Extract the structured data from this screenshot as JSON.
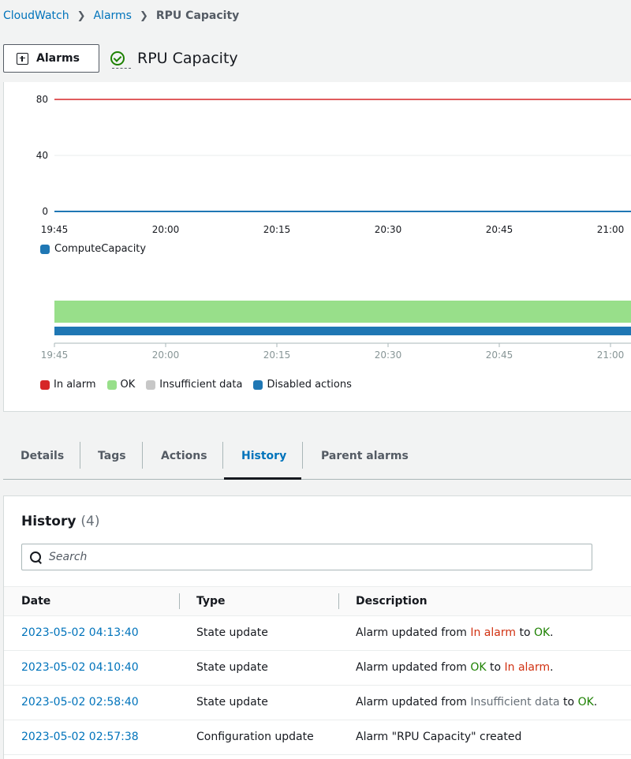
{
  "breadcrumb": {
    "items": [
      "CloudWatch",
      "Alarms"
    ],
    "current": "RPU Capacity"
  },
  "header": {
    "alarms_button": "Alarms",
    "title": "RPU Capacity",
    "status": "ok"
  },
  "metric_chart": {
    "y_ticks": [
      "80",
      "40",
      "0"
    ],
    "x_ticks": [
      "19:45",
      "20:00",
      "20:15",
      "20:30",
      "20:45",
      "21:00"
    ],
    "threshold": 80,
    "legend": [
      "ComputeCapacity"
    ],
    "series_color": "#1f77b4",
    "threshold_color": "#d62728"
  },
  "status_chart": {
    "x_ticks": [
      "19:45",
      "20:00",
      "20:15",
      "20:30",
      "20:45",
      "21:00"
    ],
    "legend": [
      {
        "label": "In alarm",
        "color": "#d62728"
      },
      {
        "label": "OK",
        "color": "#98df8a"
      },
      {
        "label": "Insufficient data",
        "color": "#c7c7c7"
      },
      {
        "label": "Disabled actions",
        "color": "#1f77b4"
      }
    ]
  },
  "tabs": [
    {
      "label": "Details",
      "active": false
    },
    {
      "label": "Tags",
      "active": false
    },
    {
      "label": "Actions",
      "active": false
    },
    {
      "label": "History",
      "active": true
    },
    {
      "label": "Parent alarms",
      "active": false
    }
  ],
  "history": {
    "title": "History",
    "count": "(4)",
    "search_placeholder": "Search",
    "columns": [
      "Date",
      "Type",
      "Description"
    ],
    "rows": [
      {
        "date": "2023-05-02 04:13:40",
        "type": "State update",
        "desc": [
          {
            "t": "Alarm updated from ",
            "c": ""
          },
          {
            "t": "In alarm",
            "c": "red"
          },
          {
            "t": " to ",
            "c": ""
          },
          {
            "t": "OK",
            "c": "green"
          },
          {
            "t": ".",
            "c": ""
          }
        ]
      },
      {
        "date": "2023-05-02 04:10:40",
        "type": "State update",
        "desc": [
          {
            "t": "Alarm updated from ",
            "c": ""
          },
          {
            "t": "OK",
            "c": "green"
          },
          {
            "t": " to ",
            "c": ""
          },
          {
            "t": "In alarm",
            "c": "red"
          },
          {
            "t": ".",
            "c": ""
          }
        ]
      },
      {
        "date": "2023-05-02 02:58:40",
        "type": "State update",
        "desc": [
          {
            "t": "Alarm updated from ",
            "c": ""
          },
          {
            "t": "Insufficient data",
            "c": "gray"
          },
          {
            "t": " to ",
            "c": ""
          },
          {
            "t": "OK",
            "c": "green"
          },
          {
            "t": ".",
            "c": ""
          }
        ]
      },
      {
        "date": "2023-05-02 02:57:38",
        "type": "Configuration update",
        "desc": [
          {
            "t": "Alarm \"RPU Capacity\" created",
            "c": ""
          }
        ]
      }
    ]
  }
}
